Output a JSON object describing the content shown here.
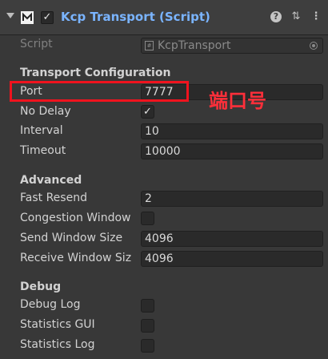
{
  "header": {
    "title": "Kcp Transport (Script)",
    "enabled_check": "✓",
    "icons": [
      "foldout-arrow-icon",
      "kcp-logo-icon",
      "help-icon",
      "preset-sliders-icon",
      "more-options-icon"
    ],
    "help_glyph": "?",
    "sliders_glyph": "⇅",
    "dots_glyph": "⋮"
  },
  "script_row": {
    "label": "Script",
    "value": "KcpTransport"
  },
  "transport": {
    "section": "Transport Configuration",
    "port_label": "Port",
    "port_value": "7777",
    "nodelay_label": "No Delay",
    "nodelay_check": "✓",
    "interval_label": "Interval",
    "interval_value": "10",
    "timeout_label": "Timeout",
    "timeout_value": "10000"
  },
  "advanced": {
    "section": "Advanced",
    "fastresend_label": "Fast Resend",
    "fastresend_value": "2",
    "congestion_label": "Congestion Window",
    "send_label": "Send Window Size",
    "send_value": "4096",
    "receive_label": "Receive Window Siz",
    "receive_value": "4096"
  },
  "debug": {
    "section": "Debug",
    "log_label": "Debug Log",
    "gui_label": "Statistics GUI",
    "stats_log_label": "Statistics Log"
  },
  "annotation": {
    "text": "端口号",
    "color": "#ff2f3a"
  },
  "colors": {
    "title": "#7ab4ff",
    "highlight": "#f0131e",
    "background": "#383838"
  }
}
